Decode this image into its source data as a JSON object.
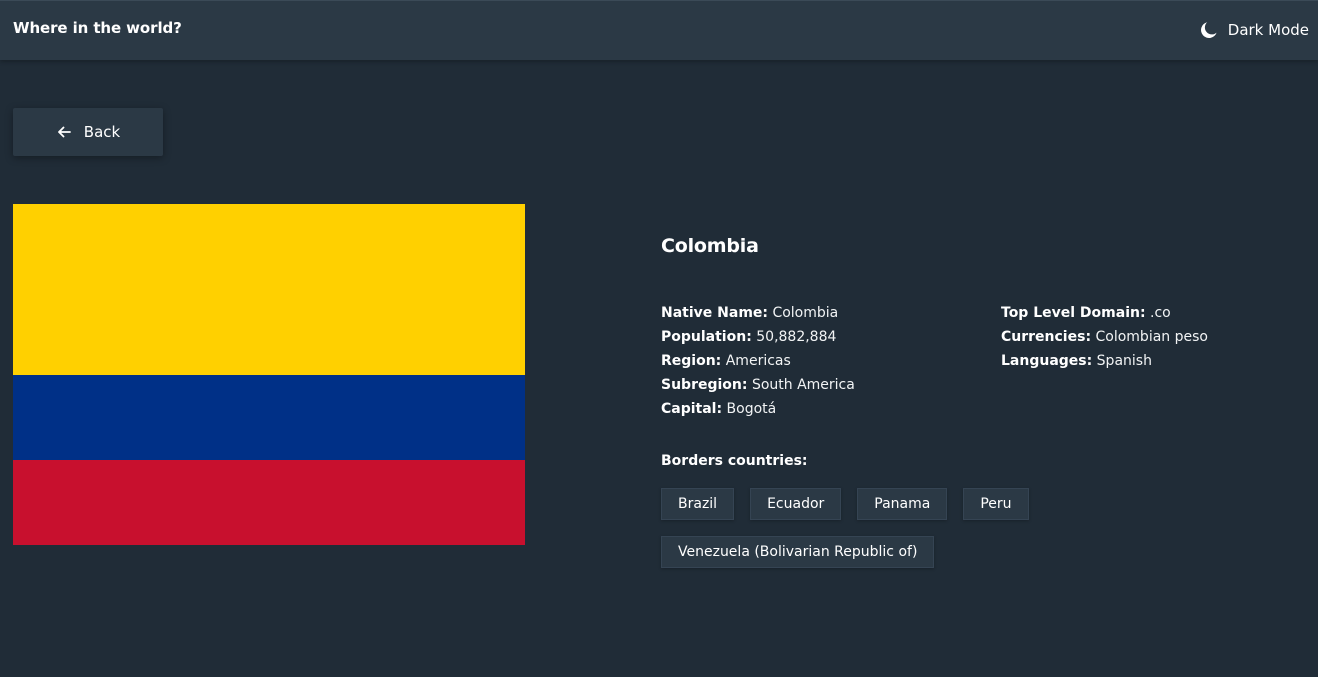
{
  "header": {
    "title": "Where in the world?",
    "theme_toggle_label": "Dark Mode",
    "theme_icon": "moon-icon"
  },
  "back_button": {
    "label": "Back",
    "icon": "arrow-left-icon"
  },
  "flag": {
    "colors": [
      "#ffd000",
      "#003087",
      "#c8102e"
    ]
  },
  "country": {
    "name": "Colombia",
    "details_left": [
      {
        "label": "Native Name:",
        "value": "Colombia"
      },
      {
        "label": "Population:",
        "value": "50,882,884"
      },
      {
        "label": "Region:",
        "value": "Americas"
      },
      {
        "label": "Subregion:",
        "value": "South America"
      },
      {
        "label": "Capital:",
        "value": "Bogotá"
      }
    ],
    "details_right": [
      {
        "label": "Top Level Domain:",
        "value": ".co"
      },
      {
        "label": "Currencies:",
        "value": "Colombian peso"
      },
      {
        "label": "Languages:",
        "value": "Spanish"
      }
    ],
    "borders_label": "Borders countries:",
    "borders": [
      "Brazil",
      "Ecuador",
      "Panama",
      "Peru",
      "Venezuela (Bolivarian Republic of)"
    ]
  },
  "colors": {
    "background": "#202c37",
    "element": "#2b3945",
    "text": "#ffffff"
  }
}
